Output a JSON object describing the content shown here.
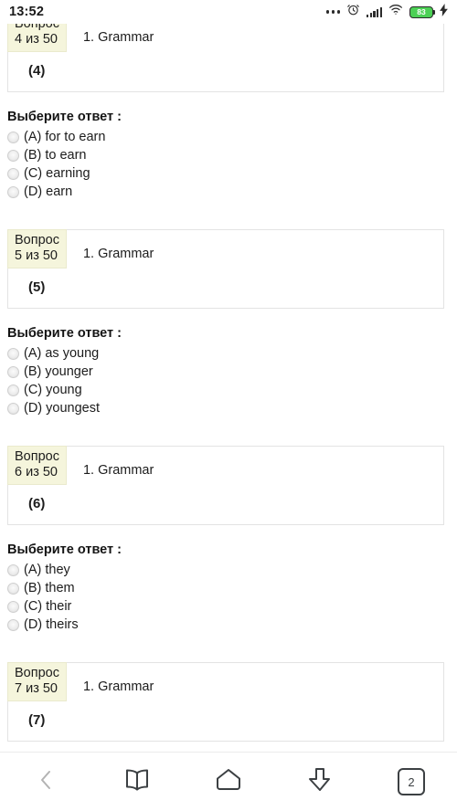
{
  "statusbar": {
    "time": "13:52",
    "icons": [
      "more-dots-icon",
      "alarm-clock-icon",
      "signal-bars-icon",
      "wifi-icon",
      "battery-icon",
      "charging-bolt-icon"
    ],
    "battery_level": "83"
  },
  "answers_heading": "Выберите ответ :",
  "questions": [
    {
      "badge_line1": "Вопрос",
      "badge_line2": "4 из 50",
      "title": "1. Grammar",
      "body": "(4)",
      "options": [
        "(A) for to earn",
        "(B) to earn",
        "(C) earning",
        "(D) earn"
      ]
    },
    {
      "badge_line1": "Вопрос",
      "badge_line2": "5 из 50",
      "title": "1. Grammar",
      "body": "(5)",
      "options": [
        "(A) as young",
        "(B) younger",
        "(C) young",
        "(D) youngest"
      ]
    },
    {
      "badge_line1": "Вопрос",
      "badge_line2": "6 из 50",
      "title": "1. Grammar",
      "body": "(6)",
      "options": [
        "(A) they",
        "(B) them",
        "(C) their",
        "(D) theirs"
      ]
    },
    {
      "badge_line1": "Вопрос",
      "badge_line2": "7 из 50",
      "title": "1. Grammar",
      "body": "(7)",
      "options": []
    }
  ],
  "navbar": {
    "back": "back-chevron",
    "bookmarks": "open-book",
    "home": "home-pentagon",
    "downloads": "down-arrow",
    "tabs_count": "2"
  },
  "colors": {
    "badge_bg": "#f5f5dc",
    "card_border": "#e3e3e3",
    "battery_green": "#4cd055",
    "nav_icon": "#3c4043"
  }
}
